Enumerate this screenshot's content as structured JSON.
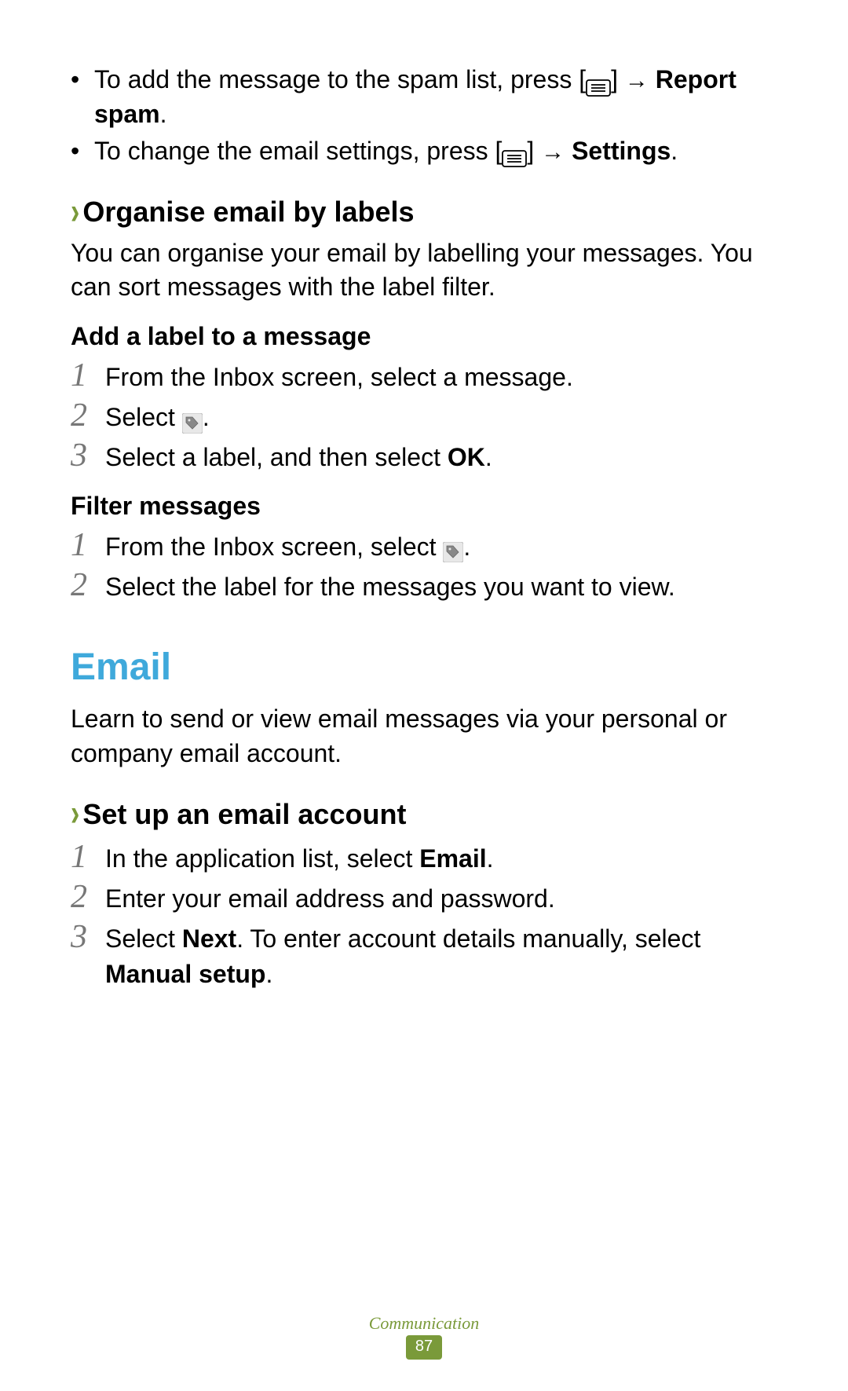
{
  "bullets": {
    "spam": {
      "pre": "To add the message to the spam list, press [",
      "post": "] ",
      "arrow": "→",
      "bold": " Report spam",
      "end": "."
    },
    "settings": {
      "pre": "To change the email settings, press [",
      "post": "] ",
      "arrow": "→",
      "bold": " Settings",
      "end": "."
    }
  },
  "organise": {
    "title": "Organise email by labels",
    "body": "You can organise your email by labelling your messages. You can sort messages with the label filter.",
    "addLabel": {
      "heading": "Add a label to a message",
      "step1": "From the Inbox screen, select a message.",
      "step2_pre": "Select ",
      "step2_post": ".",
      "step3_pre": "Select a label, and then select ",
      "step3_bold": "OK",
      "step3_post": "."
    },
    "filter": {
      "heading": "Filter messages",
      "step1_pre": "From the Inbox screen, select ",
      "step1_post": ".",
      "step2": "Select the label for the messages you want to view."
    }
  },
  "email": {
    "title": "Email",
    "intro": "Learn to send or view email messages via your personal or company email account.",
    "setup": {
      "title": "Set up an email account",
      "step1_pre": "In the application list, select ",
      "step1_bold": "Email",
      "step1_post": ".",
      "step2": "Enter your email address and password.",
      "step3_pre": "Select ",
      "step3_bold1": "Next",
      "step3_mid": ". To enter account details manually, select ",
      "step3_bold2": "Manual setup",
      "step3_post": "."
    }
  },
  "numbers": {
    "n1": "1",
    "n2": "2",
    "n3": "3"
  },
  "footer": {
    "section": "Communication",
    "page": "87"
  },
  "chevron": "›"
}
